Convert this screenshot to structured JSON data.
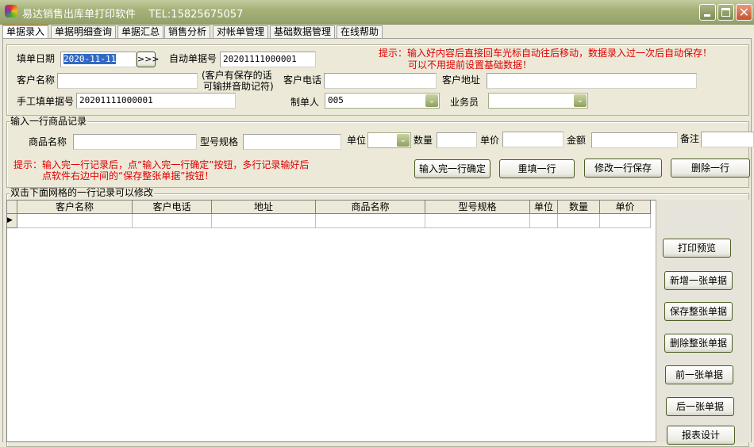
{
  "window": {
    "title": "易达销售出库单打印软件    TEL:15825675057"
  },
  "tabs": [
    "单据录入",
    "单据明细查询",
    "单据汇总",
    "销售分析",
    "对帐单管理",
    "基础数据管理",
    "在线帮助"
  ],
  "header": {
    "date_label": "填单日期",
    "date_value": "2020-11-11",
    "date_button": ">>>",
    "auto_no_label": "自动单据号",
    "auto_no_value": "20201111000001",
    "customer_name_label": "客户名称",
    "customer_hint_1": "(客户有保存的话",
    "customer_hint_2": "可输拼音助记符)",
    "customer_phone_label": "客户电话",
    "customer_address_label": "客户地址",
    "manual_no_label": "手工填单据号",
    "manual_no_value": "20201111000001",
    "maker_label": "制单人",
    "maker_value": "005",
    "salesman_label": "业务员",
    "tip_1": "提示：输入好内容后直接回车光标自动往后移动，数据录入过一次后自动保存！",
    "tip_2": "可以不用提前设置基础数据！"
  },
  "item_entry": {
    "legend": "输入一行商品记录",
    "product_label": "商品名称",
    "model_label": "型号规格",
    "unit_label": "单位",
    "qty_label": "数量",
    "price_label": "单价",
    "amount_label": "金额",
    "note_label": "备注",
    "tip_1": "提示：输入完一行记录后，点“输入完一行确定”按钮，多行记录输好后",
    "tip_2": "点软件右边中间的“保存整张单据”按钮！",
    "buttons": [
      "输入完一行确定",
      "重填一行",
      "修改一行保存",
      "删除一行"
    ]
  },
  "grid": {
    "legend": "双击下面网格的一行记录可以修改",
    "columns": [
      "客户名称",
      "客户电话",
      "地址",
      "商品名称",
      "型号规格",
      "单位",
      "数量",
      "单价"
    ]
  },
  "side_buttons": [
    "打印预览",
    "新增一张单据",
    "保存整张单据",
    "删除整张单据",
    "前一张单据",
    "后一张单据",
    "报表设计"
  ]
}
